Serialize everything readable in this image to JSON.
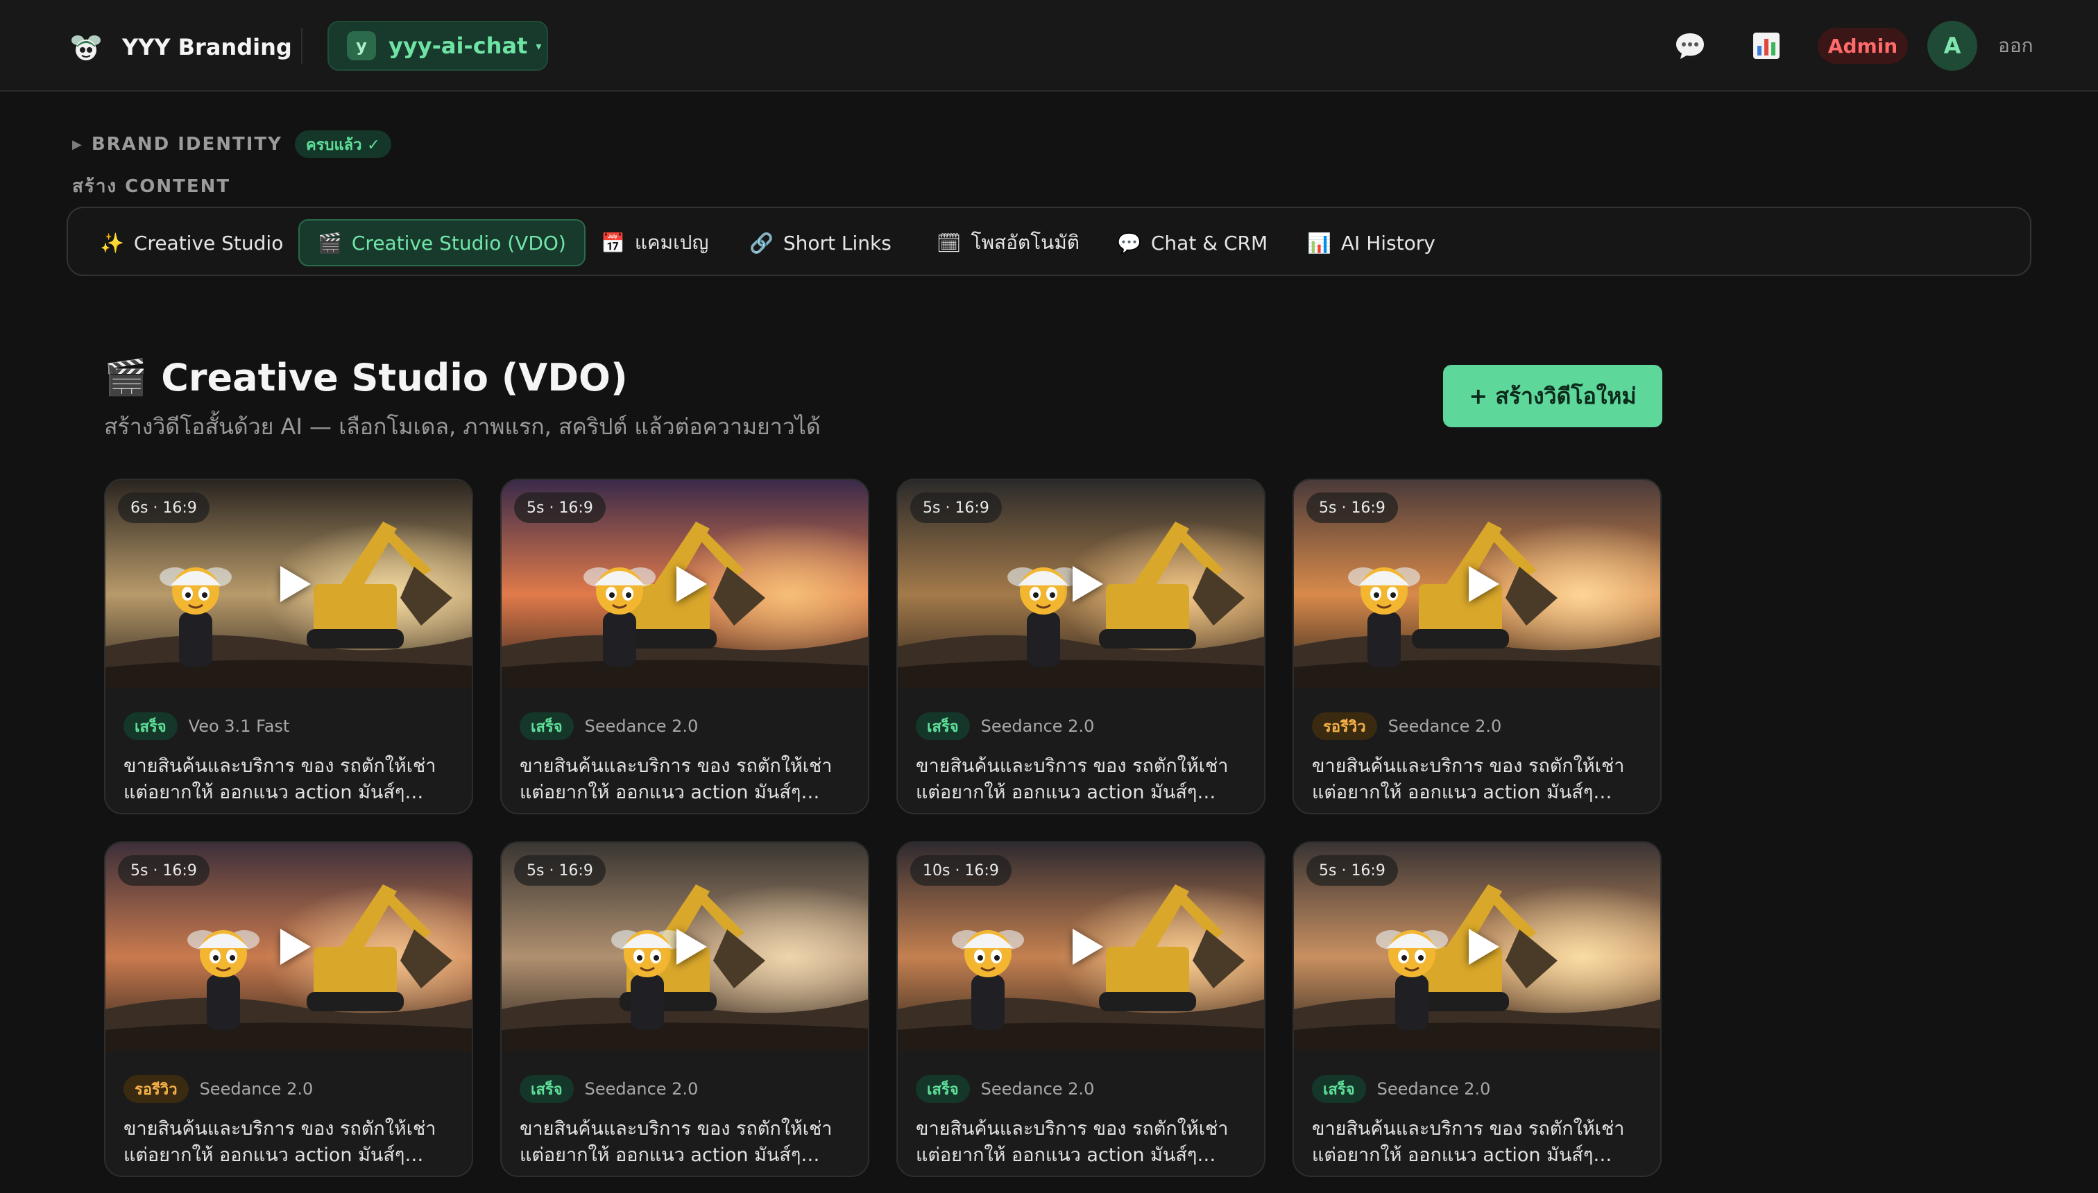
{
  "topbar": {
    "brand_name": "YYY Branding",
    "workspace": {
      "avatar_letter": "y",
      "name": "yyy-ai-chat",
      "caret": "▾"
    },
    "icons": [
      "chat-icon",
      "chart-icon"
    ],
    "admin_label": "Admin",
    "user_avatar_letter": "A",
    "logout_label": "ออก"
  },
  "sections": {
    "brand_identity": {
      "label": "BRAND IDENTITY",
      "badge": "ครบแล้ว ✓"
    },
    "create_content_label": "สร้าง CONTENT"
  },
  "tabs": [
    {
      "icon": "✨",
      "label": "Creative Studio",
      "active": false
    },
    {
      "icon": "🎬",
      "label": "Creative Studio (VDO)",
      "active": true
    },
    {
      "icon": "📅",
      "label": "แคมเปญ",
      "active": false
    },
    {
      "icon": "🔗",
      "label": "Short Links",
      "active": false
    },
    {
      "icon": "🗓",
      "label": "โพสอัตโนมัติ",
      "active": false
    },
    {
      "icon": "💬",
      "label": "Chat & CRM",
      "active": false
    },
    {
      "icon": "📊",
      "label": "AI History",
      "active": false
    }
  ],
  "page": {
    "title_icon": "🎬",
    "title": "Creative Studio (VDO)",
    "subtitle": "สร้างวิดีโอสั้นด้วย AI — เลือกโมเดล, ภาพแรก, สคริปต์ แล้วต่อความยาวได้",
    "new_button_label": "+ สร้างวิดีโอใหม่"
  },
  "videos": [
    {
      "duration": "6s · 16:9",
      "status": "เสร็จ",
      "status_type": "done",
      "model": "Veo 3.1 Fast",
      "description": "ขายสินค้นและบริการ ของ รถตักให้เช่าแต่อยากให้ ออกแนว action มันส์ๆ หน่อย ..."
    },
    {
      "duration": "5s · 16:9",
      "status": "เสร็จ",
      "status_type": "done",
      "model": "Seedance 2.0",
      "description": "ขายสินค้นและบริการ ของ รถตักให้เช่าแต่อยากให้ ออกแนว action มันส์ๆ หน่อย ..."
    },
    {
      "duration": "5s · 16:9",
      "status": "เสร็จ",
      "status_type": "done",
      "model": "Seedance 2.0",
      "description": "ขายสินค้นและบริการ ของ รถตักให้เช่าแต่อยากให้ ออกแนว action มันส์ๆ หน่อย ..."
    },
    {
      "duration": "5s · 16:9",
      "status": "รอรีวิว",
      "status_type": "review",
      "model": "Seedance 2.0",
      "description": "ขายสินค้นและบริการ ของ รถตักให้เช่าแต่อยากให้ ออกแนว action มันส์ๆ หน่อย ..."
    },
    {
      "duration": "5s · 16:9",
      "status": "รอรีวิว",
      "status_type": "review",
      "model": "Seedance 2.0",
      "description": "ขายสินค้นและบริการ ของ รถตักให้เช่าแต่อยากให้ ออกแนว action มันส์ๆ หน่อย ..."
    },
    {
      "duration": "5s · 16:9",
      "status": "เสร็จ",
      "status_type": "done",
      "model": "Seedance 2.0",
      "description": "ขายสินค้นและบริการ ของ รถตักให้เช่าแต่อยากให้ ออกแนว action มันส์ๆ หน่อย ..."
    },
    {
      "duration": "10s · 16:9",
      "status": "เสร็จ",
      "status_type": "done",
      "model": "Seedance 2.0",
      "description": "ขายสินค้นและบริการ ของ รถตักให้เช่าแต่อยากให้ ออกแนว action มันส์ๆ หน่อย ..."
    },
    {
      "duration": "5s · 16:9",
      "status": "เสร็จ",
      "status_type": "done",
      "model": "Seedance 2.0",
      "description": "ขายสินค้นและบริการ ของ รถตักให้เช่าแต่อยากให้ ออกแนว action มันส์ๆ หน่อย ..."
    }
  ],
  "colors": {
    "accent": "#5ed79b",
    "status_done": "#5fe09a",
    "status_review": "#f5b04a",
    "admin": "#ff6b6b"
  }
}
